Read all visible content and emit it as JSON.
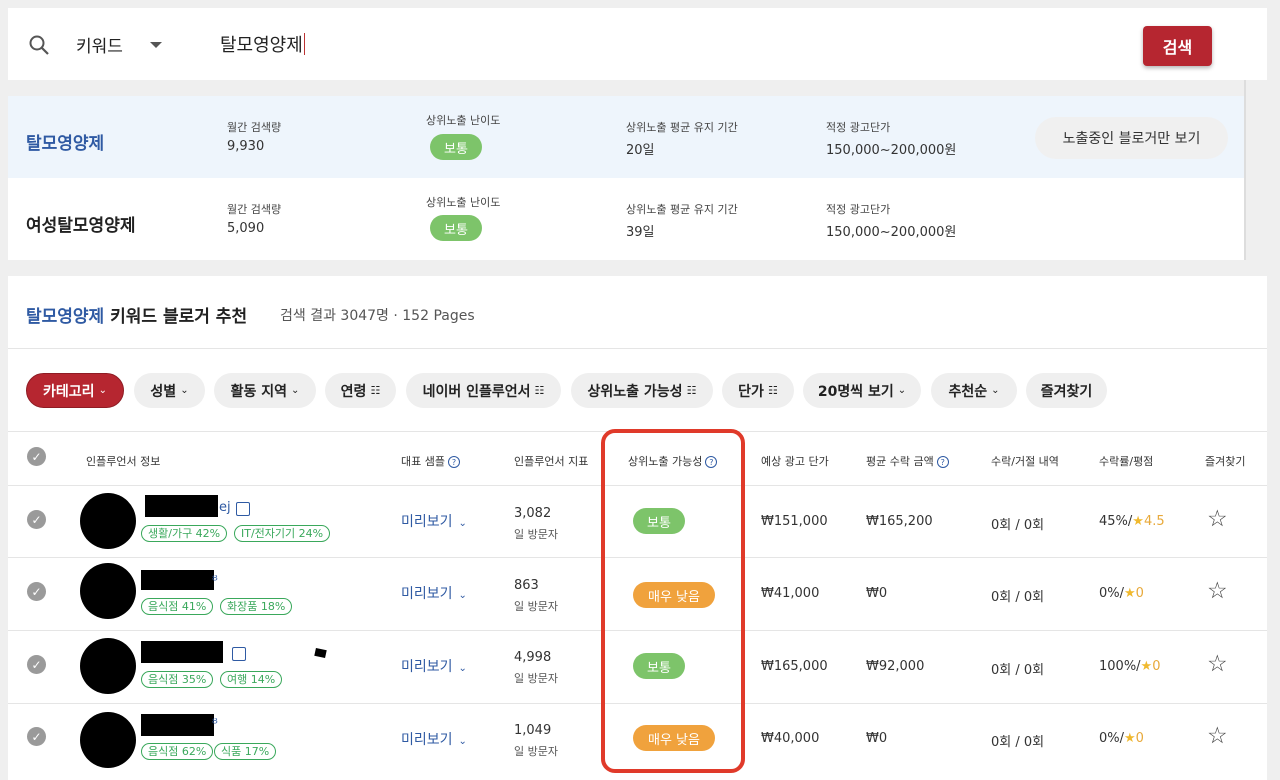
{
  "search": {
    "type_label": "키워드",
    "query": "탈모영양제",
    "button": "검색"
  },
  "keywords": [
    {
      "name": "탈모영양제",
      "volume_label": "월간 검색량",
      "volume": "9,930",
      "difficulty_label": "상위노출 난이도",
      "difficulty": "보통",
      "duration_label": "상위노출 평균 유지 기간",
      "duration": "20일",
      "price_label": "적정 광고단가",
      "price": "150,000~200,000원"
    },
    {
      "name": "여성탈모영양제",
      "volume_label": "월간 검색량",
      "volume": "5,090",
      "difficulty_label": "상위노출 난이도",
      "difficulty": "보통",
      "duration_label": "상위노출 평균 유지 기간",
      "duration": "39일",
      "price_label": "적정 광고단가",
      "price": "150,000~200,000원"
    }
  ],
  "exposed_button": "노출중인 블로거만 보기",
  "recommend": {
    "keyword": "탈모영양제",
    "title_rest": " 키워드 블로거 추천",
    "count": "검색 결과 3047명 · 152 Pages"
  },
  "filters": [
    {
      "label": "카테고리",
      "suffix": "⌄"
    },
    {
      "label": "성별",
      "suffix": "⌄"
    },
    {
      "label": "활동 지역",
      "suffix": "⌄"
    },
    {
      "label": "연령",
      "suffix": "☷"
    },
    {
      "label": "네이버 인플루언서",
      "suffix": "☷"
    },
    {
      "label": "상위노출 가능성",
      "suffix": "☷"
    },
    {
      "label": "단가",
      "suffix": "☷"
    },
    {
      "label": "20명씩 보기",
      "suffix": "⌄"
    },
    {
      "label": "추천순",
      "suffix": "⌄"
    },
    {
      "label": "즐겨찾기",
      "suffix": ""
    }
  ],
  "table": {
    "headers": {
      "info": "인플루언서 정보",
      "sample": "대표 샘플",
      "index": "인플루언서 지표",
      "possibility": "상위노출 가능성",
      "ad_price": "예상 광고 단가",
      "avg_income": "평균 수락 금액",
      "history": "수락/거절 내역",
      "rate": "수락률/평점",
      "fav": "즐겨찾기"
    },
    "rows": [
      {
        "handle_tail": "ej",
        "tags": [
          "생활/가구 42%",
          "IT/전자기기 24%"
        ],
        "preview": "미리보기",
        "visitors": "3,082",
        "visitors_label": "일 방문자",
        "possibility": "보통",
        "ad_price": "₩151,000",
        "avg_income": "₩165,200",
        "history": "0회 / 0회",
        "rate": "45%/",
        "score": "4.5"
      },
      {
        "handle_tail": "",
        "tags": [
          "음식점 41%",
          "화장품 18%"
        ],
        "preview": "미리보기",
        "visitors": "863",
        "visitors_label": "일 방문자",
        "possibility": "매우 낮음",
        "ad_price": "₩41,000",
        "avg_income": "₩0",
        "history": "0회 / 0회",
        "rate": "0%/",
        "score": "0"
      },
      {
        "handle_tail": "",
        "tags": [
          "음식점 35%",
          "여행 14%"
        ],
        "preview": "미리보기",
        "visitors": "4,998",
        "visitors_label": "일 방문자",
        "possibility": "보통",
        "ad_price": "₩165,000",
        "avg_income": "₩92,000",
        "history": "0회 / 0회",
        "rate": "100%/",
        "score": "0"
      },
      {
        "handle_tail": "",
        "tags": [
          "음식점 62%",
          "식품 17%"
        ],
        "preview": "미리보기",
        "visitors": "1,049",
        "visitors_label": "일 방문자",
        "possibility": "매우 낮음",
        "ad_price": "₩40,000",
        "avg_income": "₩0",
        "history": "0회 / 0회",
        "rate": "0%/",
        "score": "0"
      }
    ]
  },
  "colors": {
    "accent": "#b62630",
    "link": "#2f5aa3",
    "green": "#7dc46a",
    "orange": "#f0a23d",
    "highlight": "#e03a2a"
  }
}
